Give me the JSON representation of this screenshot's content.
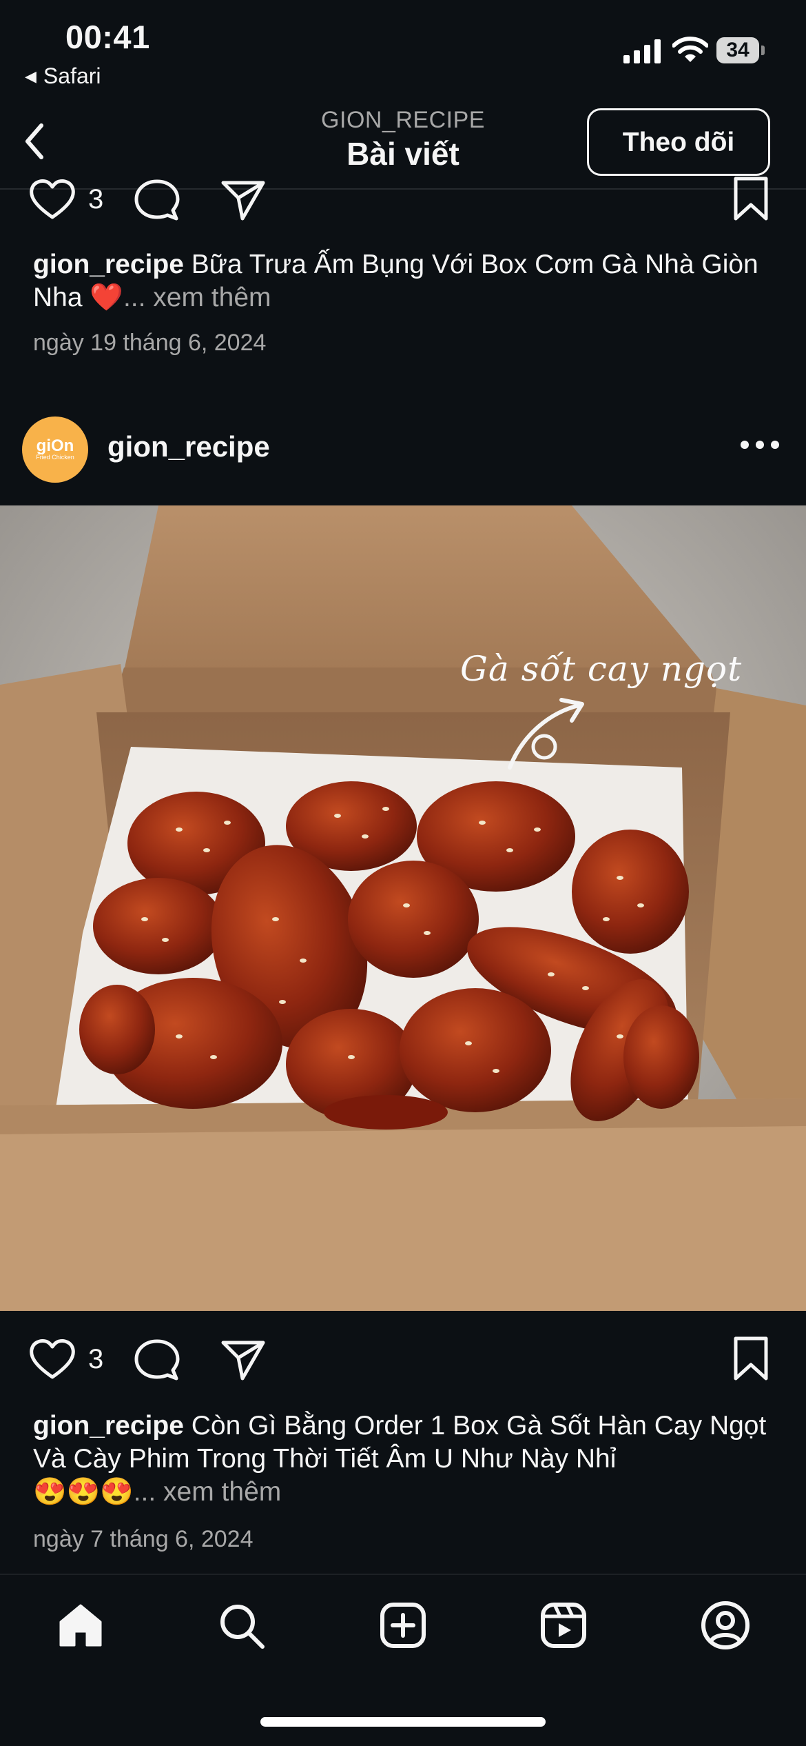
{
  "status_bar": {
    "time": "00:41",
    "back_app": "Safari",
    "battery": "34"
  },
  "header": {
    "account": "GION_RECIPE",
    "title": "Bài viết",
    "follow_label": "Theo dõi"
  },
  "post1": {
    "likes": "3",
    "username": "gion_recipe",
    "caption": "Bữa Trưa Ấm Bụng Với Box Cơm Gà Nhà Giòn Nha",
    "caption_emoji": "❤️",
    "more": "... xem thêm",
    "date": "ngày 19 tháng 6, 2024"
  },
  "post2": {
    "username": "gion_recipe",
    "avatar_text": "giOn",
    "avatar_subtext": "Fried Chicken",
    "image_text": "Gà sốt cay ngọt",
    "likes": "3",
    "caption_username": "gion_recipe",
    "caption": "Còn Gì Bằng Order 1 Box Gà Sốt Hàn Cay Ngọt Và Cày Phim Trong Thời Tiết Âm U Như Này Nhỉ",
    "caption_emoji": "😍😍😍",
    "more": "... xem thêm",
    "date": "ngày 7 tháng 6, 2024"
  },
  "bottom_nav": {
    "items": [
      {
        "name": "home",
        "icon": "home-icon",
        "active": true
      },
      {
        "name": "search",
        "icon": "search-icon"
      },
      {
        "name": "create",
        "icon": "plus-square-icon"
      },
      {
        "name": "reels",
        "icon": "reels-icon"
      },
      {
        "name": "profile",
        "icon": "profile-icon"
      }
    ]
  },
  "colors": {
    "background": "#0c1014",
    "text": "#f5f5f5",
    "muted": "#a8a8a8",
    "avatar": "#f8b24a"
  }
}
